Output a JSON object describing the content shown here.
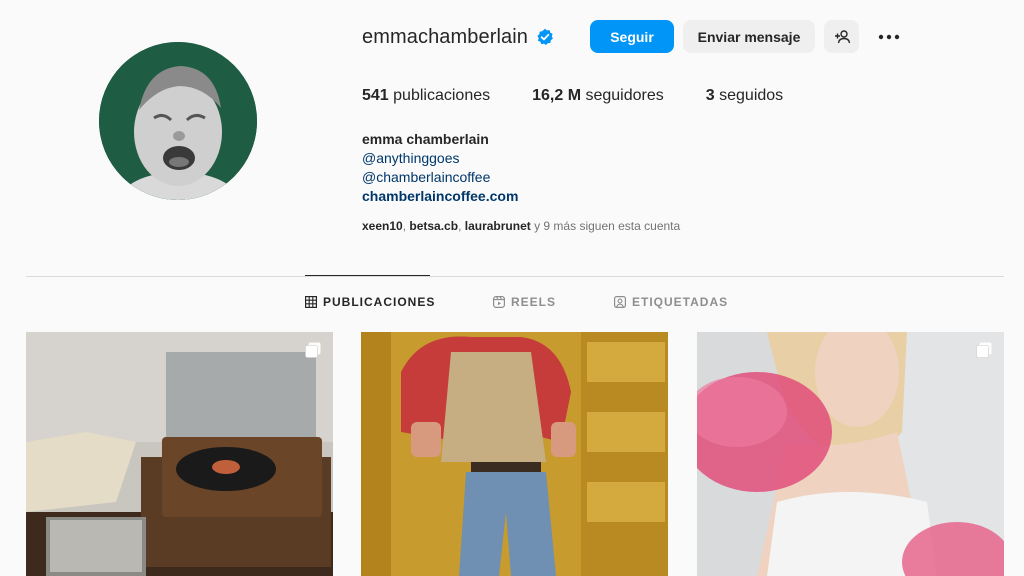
{
  "profile": {
    "username": "emmachamberlain",
    "verified": true,
    "follow_label": "Seguir",
    "message_label": "Enviar mensaje",
    "suggest_icon": "add-person-icon",
    "more_icon": "more-options-icon"
  },
  "stats": {
    "posts_count": "541",
    "posts_label": "publicaciones",
    "followers_count": "16,2 M",
    "followers_label": "seguidores",
    "following_count": "3",
    "following_label": "seguidos"
  },
  "bio": {
    "name": "emma chamberlain",
    "mention1": "@anythinggoes",
    "mention2": "@chamberlaincoffee",
    "website": "chamberlaincoffee.com"
  },
  "followed_by": {
    "user1": "xeen10",
    "user2": "betsa.cb",
    "user3": "laurabrunet",
    "suffix": "y 9 más siguen esta cuenta"
  },
  "tabs": [
    {
      "label": "PUBLICACIONES",
      "icon": "grid-icon",
      "active": true
    },
    {
      "label": "REELS",
      "icon": "reels-icon",
      "active": false
    },
    {
      "label": "ETIQUETADAS",
      "icon": "tagged-icon",
      "active": false
    }
  ],
  "colors": {
    "accent": "#0095f6",
    "link": "#00376b",
    "avatar_bg": "#1f5c44"
  }
}
